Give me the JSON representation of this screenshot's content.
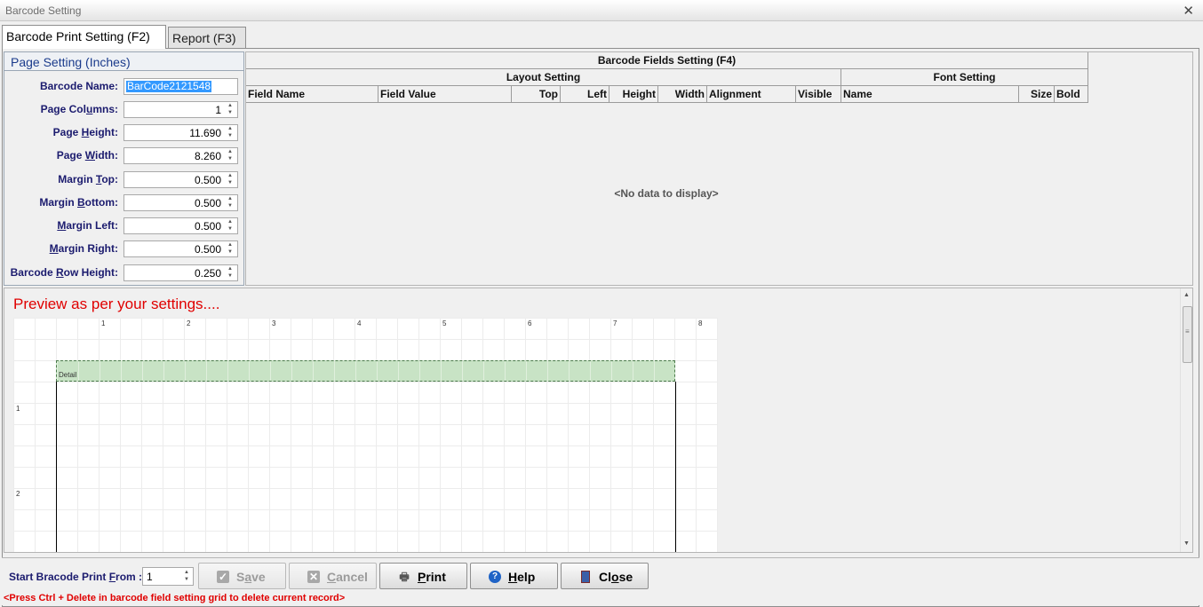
{
  "window": {
    "title": "Barcode Setting",
    "close_glyph": "✕"
  },
  "tabs": [
    {
      "label": "Barcode Print Setting (F2)",
      "active": true
    },
    {
      "label": "Report (F3)",
      "active": false
    }
  ],
  "page_setting": {
    "title": "Page Setting (Inches)",
    "fields": {
      "barcode_name": {
        "label_pre": "Barcode Name:",
        "value": "BarCode2121548"
      },
      "page_columns": {
        "label_pre": "Page Col",
        "label_u": "u",
        "label_post": "mns:",
        "value": "1"
      },
      "page_height": {
        "label_pre": "Page ",
        "label_u": "H",
        "label_post": "eight:",
        "value": "11.690"
      },
      "page_width": {
        "label_pre": "Page ",
        "label_u": "W",
        "label_post": "idth:",
        "value": "8.260"
      },
      "margin_top": {
        "label_pre": "Margin ",
        "label_u": "T",
        "label_post": "op:",
        "value": "0.500"
      },
      "margin_bottom": {
        "label_pre": "Margin ",
        "label_u": "B",
        "label_post": "ottom:",
        "value": "0.500"
      },
      "margin_left": {
        "label_pre": "",
        "label_u": "M",
        "label_post": "argin Left:",
        "value": "0.500"
      },
      "margin_right": {
        "label_pre": "",
        "label_u": "M",
        "label_post": "argin Right:",
        "value": "0.500"
      },
      "barcode_row_height": {
        "label_pre": "Barcode ",
        "label_u": "R",
        "label_post": "ow Height:",
        "value": "0.250"
      }
    }
  },
  "grid": {
    "title": "Barcode Fields Setting (F4)",
    "group_layout": "Layout Setting",
    "group_font": "Font Setting",
    "columns": [
      "Field Name",
      "Field Value",
      "Top",
      "Left",
      "Height",
      "Width",
      "Alignment",
      "Visible",
      "Name",
      "Size",
      "Bold"
    ],
    "empty_text": "<No data to display>"
  },
  "preview": {
    "title": "Preview as per your settings....",
    "ruler_top": [
      "1",
      "2",
      "3",
      "4",
      "5",
      "6",
      "7",
      "8"
    ],
    "ruler_left": [
      "1",
      "2"
    ],
    "band_label": "Detail"
  },
  "bottom": {
    "start_label_pre": "Start Bracode Print ",
    "start_label_u": "F",
    "start_label_post": "rom :",
    "start_value": "1",
    "buttons": {
      "save": {
        "pre": "S",
        "u": "a",
        "post": "ve",
        "icon": "check-icon"
      },
      "cancel": {
        "pre": "",
        "u": "C",
        "post": "ancel",
        "icon": "x-icon"
      },
      "print": {
        "pre": "",
        "u": "P",
        "post": "rint",
        "icon": "printer-icon"
      },
      "help": {
        "pre": "",
        "u": "H",
        "post": "elp",
        "icon": "help-icon"
      },
      "close": {
        "pre": "Cl",
        "u": "o",
        "post": "se",
        "icon": "exit-door-icon"
      }
    },
    "hint": "<Press Ctrl + Delete in barcode field setting grid to delete current record>"
  }
}
